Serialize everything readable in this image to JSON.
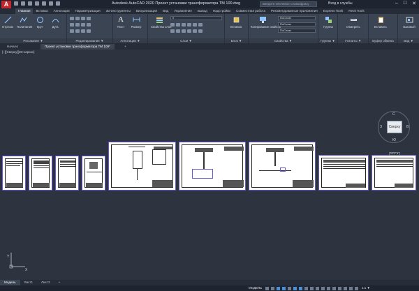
{
  "app": {
    "logo_letter": "A",
    "title": "Autodesk AutoCAD 2020   Проект установки трансформатора ТМ 100.dwg",
    "search_placeholder": "Введите ключевое слово/фразу",
    "signin": "Вход в службы"
  },
  "ribbon_tabs": [
    "Главная",
    "Вставка",
    "Аннотации",
    "Параметризация",
    "3D-инструменты",
    "Визуализация",
    "Вид",
    "Управление",
    "Вывод",
    "Надстройки",
    "Совместная работа",
    "Рекомендованные приложения",
    "Express Tools",
    "Revit Tools"
  ],
  "ribbon": {
    "draw": {
      "line": "Отрезок",
      "polyline": "Полилиния",
      "circle": "Круг",
      "arc": "Дуга",
      "panel": "Рисование ▼"
    },
    "modify": {
      "panel": "Редактирование ▼"
    },
    "annotation": {
      "text": "Текст",
      "dimension": "Размер",
      "panel": "Аннотации ▼"
    },
    "layers": {
      "properties": "Свойства слоя",
      "panel": "Слои ▼",
      "current_layer": "0"
    },
    "block": {
      "insert": "Вставка",
      "panel": "Блок ▼"
    },
    "properties": {
      "match": "Копирование свойств",
      "panel": "Свойства ▼",
      "bylayer1": "ПоСлою",
      "bylayer2": "ПоСлою",
      "bylayer3": "ПоСлою"
    },
    "groups": {
      "group": "Группа",
      "panel": "Группы ▼"
    },
    "utilities": {
      "measure": "Измерить",
      "panel": "Утилиты ▼"
    },
    "clipboard": {
      "paste": "Вставить",
      "panel": "Буфер обмена"
    },
    "view": {
      "base": "Базовый",
      "panel": "Вид ▼"
    }
  },
  "doc_tabs": {
    "start": "Начало",
    "drawing": "Проект установки трансформатора ТМ 100*",
    "add": "+"
  },
  "canvas": {
    "view_label": "[−][Сверху][2D-каркас]",
    "viewcube": {
      "face": "Сверху",
      "north": "С",
      "south": "Ю",
      "west": "З",
      "east": "В",
      "wcs": "МСК ▼"
    },
    "ucs": {
      "x": "X",
      "y": "Y"
    }
  },
  "layout_tabs": [
    "Модель",
    "Лист1",
    "Лист2",
    "+"
  ],
  "status": {
    "model": "МОДЕЛЬ",
    "scale": "1:1 ▼"
  },
  "colors": {
    "sheet_border": "#6a5acd",
    "canvas_bg": "#2d3440",
    "ribbon_bg": "#3b4453",
    "logo": "#c1272d"
  }
}
